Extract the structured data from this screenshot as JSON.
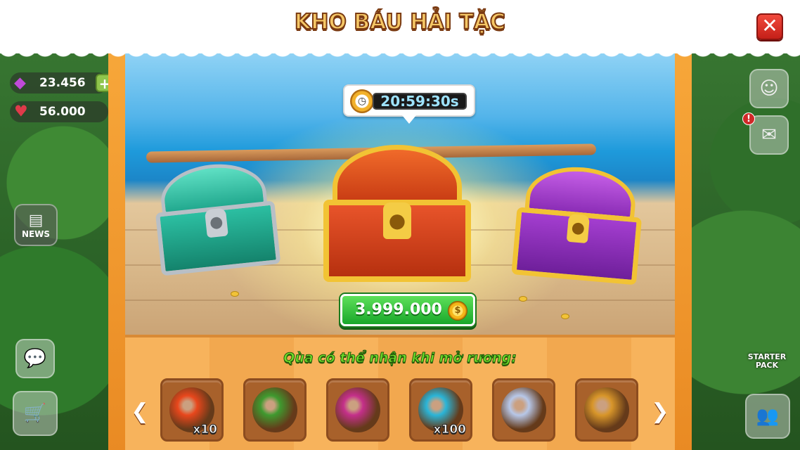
{
  "header": {
    "title": "KHO BÁU HẢI TẶC",
    "close_label": "✕"
  },
  "hud": {
    "gems": "23.456",
    "hearts": "56.000",
    "gem_icon": "gem-icon",
    "heart_icon": "heart-icon",
    "plus_label": "+",
    "news_label": "NEWS",
    "starter_label": "STARTER PACK",
    "alert_label": "!"
  },
  "chest": {
    "timer": "20:59:30s",
    "price": "3.999.000",
    "coin_symbol": "$"
  },
  "rewards": {
    "title": "Qùa có thể nhận khi mở rương:",
    "items": [
      {
        "count": "x10",
        "color": "#e8471c"
      },
      {
        "count": "",
        "color": "#3f9a2f"
      },
      {
        "count": "",
        "color": "#c42f8a"
      },
      {
        "count": "x100",
        "color": "#2ab5d8"
      },
      {
        "count": "",
        "color": "#b7c7e8"
      },
      {
        "count": "",
        "color": "#d8962a"
      }
    ],
    "prev_label": "❮",
    "next_label": "❯"
  },
  "colors": {
    "frame": "#f7a73a",
    "button_green": "#19a72a",
    "close_red": "#e03028",
    "title_gold": "#f5c766"
  }
}
